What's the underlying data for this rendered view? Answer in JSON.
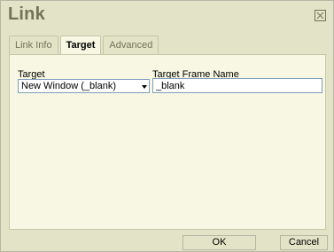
{
  "dialog": {
    "title": "Link",
    "close_icon": "close-icon"
  },
  "tabs": [
    {
      "label": "Link Info",
      "active": false
    },
    {
      "label": "Target",
      "active": true
    },
    {
      "label": "Advanced",
      "active": false
    }
  ],
  "target": {
    "label": "Target",
    "selected_value": "New Window (_blank)"
  },
  "frame_name": {
    "label": "Target Frame Name",
    "value": "_blank"
  },
  "footer": {
    "ok_label": "OK",
    "cancel_label": "Cancel"
  }
}
